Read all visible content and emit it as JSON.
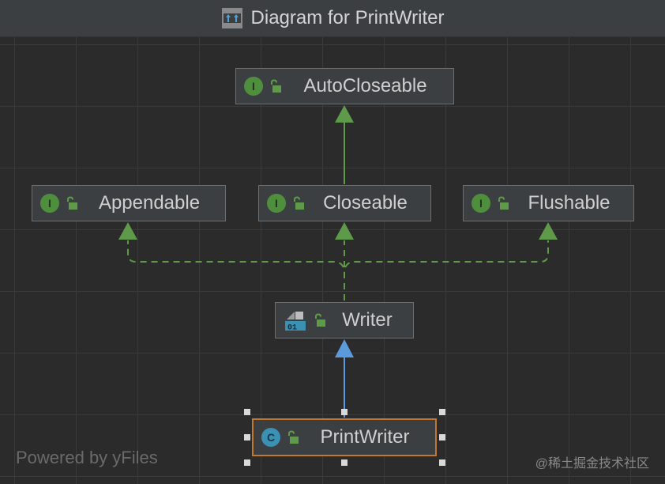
{
  "window": {
    "title": "Diagram for PrintWriter",
    "icon": "diagram-icon"
  },
  "nodes": {
    "autocloseable": {
      "label": "AutoCloseable",
      "kind": "interface",
      "badge": "I",
      "visibility": "public"
    },
    "appendable": {
      "label": "Appendable",
      "kind": "interface",
      "badge": "I",
      "visibility": "public"
    },
    "closeable": {
      "label": "Closeable",
      "kind": "interface",
      "badge": "I",
      "visibility": "public"
    },
    "flushable": {
      "label": "Flushable",
      "kind": "interface",
      "badge": "I",
      "visibility": "public"
    },
    "writer": {
      "label": "Writer",
      "kind": "abstract-class",
      "visibility": "public"
    },
    "printwriter": {
      "label": "PrintWriter",
      "kind": "class",
      "badge": "C",
      "visibility": "public",
      "selected": true
    }
  },
  "edges": [
    {
      "from": "closeable",
      "to": "autocloseable",
      "type": "extends",
      "style": "solid"
    },
    {
      "from": "writer",
      "to": "appendable",
      "type": "implements",
      "style": "dashed"
    },
    {
      "from": "writer",
      "to": "closeable",
      "type": "implements",
      "style": "dashed"
    },
    {
      "from": "writer",
      "to": "flushable",
      "type": "implements",
      "style": "dashed"
    },
    {
      "from": "printwriter",
      "to": "writer",
      "type": "extends",
      "style": "solid"
    }
  ],
  "colors": {
    "interface_edge": "#5e9a4a",
    "class_edge": "#5b9bdb",
    "selection": "#c0782f",
    "background": "#2b2b2b"
  },
  "footer": {
    "powered_by": "Powered by yFiles",
    "watermark": "@稀土掘金技术社区"
  }
}
